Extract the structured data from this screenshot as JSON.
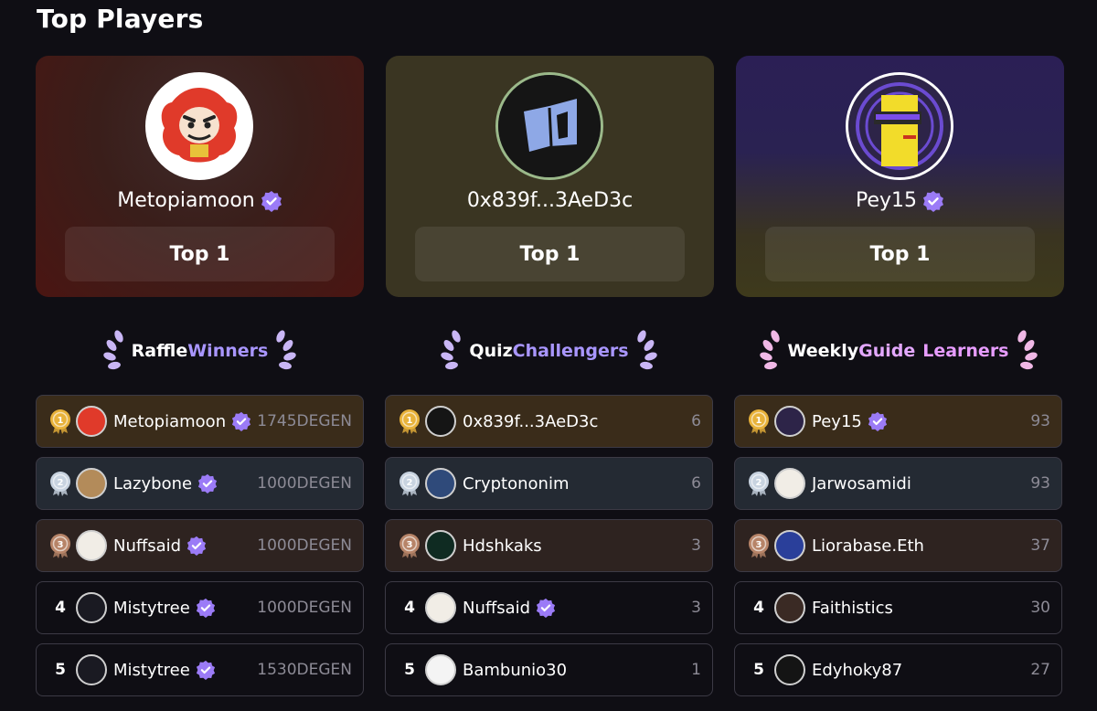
{
  "page": {
    "title": "Top Players"
  },
  "cards": [
    {
      "name": "Metopiamoon",
      "verified": true,
      "rank_label": "Top 1"
    },
    {
      "name": "0x839f...3AeD3c",
      "verified": false,
      "rank_label": "Top 1"
    },
    {
      "name": "Pey15",
      "verified": true,
      "rank_label": "Top 1"
    }
  ],
  "sections": [
    {
      "title_a": "Raffle ",
      "title_b": "Winners",
      "title_c": ""
    },
    {
      "title_a": "Quiz ",
      "title_b": "Challengers",
      "title_c": ""
    },
    {
      "title_a": "Weekly ",
      "title_b": "Guide ",
      "title_c": "Learners"
    }
  ],
  "colors": {
    "accent_purple": "#a996ff",
    "accent_pink": "#e79cff",
    "verified": "#9b7bf7",
    "gold": "#e8b23a",
    "silver": "#c8d3e0",
    "bronze": "#b78468"
  },
  "raffle": [
    {
      "rank": "1",
      "name": "Metopiamoon",
      "verified": true,
      "score": "1745DEGEN"
    },
    {
      "rank": "2",
      "name": "Lazybone",
      "verified": true,
      "score": "1000DEGEN"
    },
    {
      "rank": "3",
      "name": "Nuffsaid",
      "verified": true,
      "score": "1000DEGEN"
    },
    {
      "rank": "4",
      "name": "Mistytree",
      "verified": true,
      "score": "1000DEGEN"
    },
    {
      "rank": "5",
      "name": "Mistytree",
      "verified": true,
      "score": "1530DEGEN"
    }
  ],
  "quiz": [
    {
      "rank": "1",
      "name": "0x839f...3AeD3c",
      "verified": false,
      "score": "6"
    },
    {
      "rank": "2",
      "name": "Cryptononim",
      "verified": false,
      "score": "6"
    },
    {
      "rank": "3",
      "name": "Hdshkaks",
      "verified": false,
      "score": "3"
    },
    {
      "rank": "4",
      "name": "Nuffsaid",
      "verified": true,
      "score": "3"
    },
    {
      "rank": "5",
      "name": "Bambunio30",
      "verified": false,
      "score": "1"
    }
  ],
  "guide": [
    {
      "rank": "1",
      "name": "Pey15",
      "verified": true,
      "score": "93"
    },
    {
      "rank": "2",
      "name": "Jarwosamidi",
      "verified": false,
      "score": "93"
    },
    {
      "rank": "3",
      "name": "Liorabase.Eth",
      "verified": false,
      "score": "37"
    },
    {
      "rank": "4",
      "name": "Faithistics",
      "verified": false,
      "score": "30"
    },
    {
      "rank": "5",
      "name": "Edyhoky87",
      "verified": false,
      "score": "27"
    }
  ]
}
